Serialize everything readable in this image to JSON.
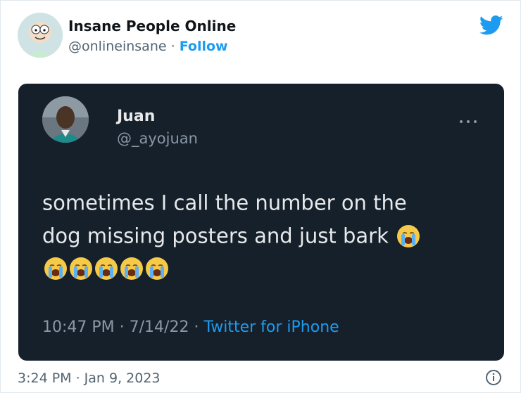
{
  "author": {
    "name": "Insane People Online",
    "handle": "@onlineinsane",
    "separator": " · ",
    "follow_label": "Follow"
  },
  "embedded_tweet": {
    "name": "Juan",
    "handle": "@_ayojuan",
    "text_line1": "sometimes I call the number on the",
    "text_line2": "dog missing posters and just bark",
    "emoji": "loudly-crying-face",
    "emoji_count": 6,
    "time": "10:47 PM",
    "date": "7/14/22",
    "source": "Twitter for iPhone"
  },
  "footer": {
    "timestamp": "3:24 PM · Jan 9, 2023"
  },
  "colors": {
    "twitter_blue": "#1d9bf0",
    "dark_bg": "#15202b",
    "muted_text": "#536471"
  }
}
